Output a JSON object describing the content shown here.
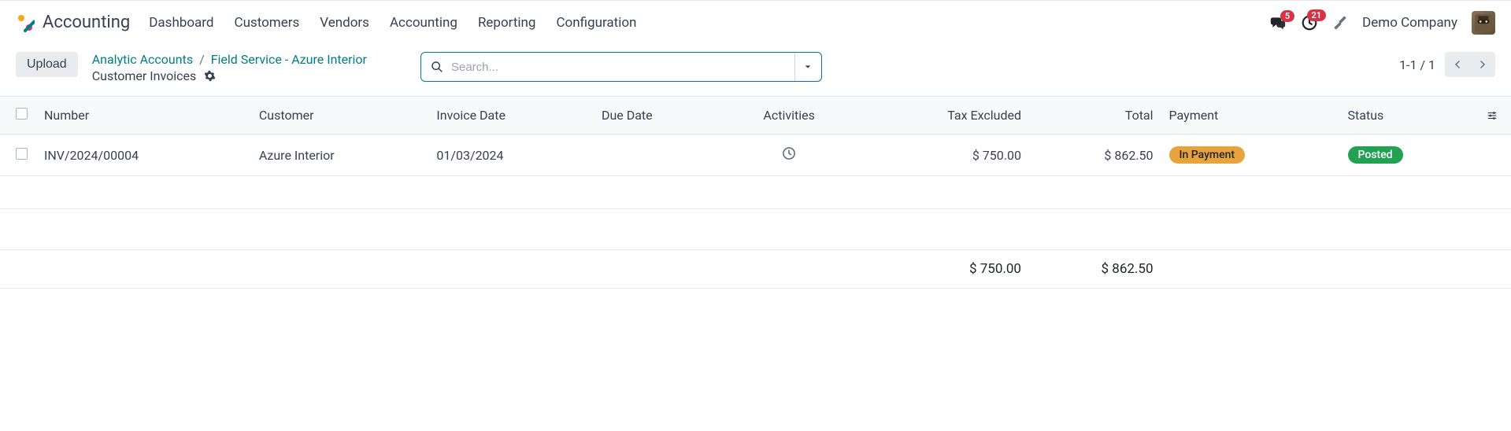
{
  "header": {
    "app_name": "Accounting",
    "nav": [
      "Dashboard",
      "Customers",
      "Vendors",
      "Accounting",
      "Reporting",
      "Configuration"
    ],
    "messages_badge": "5",
    "activities_badge": "21",
    "company": "Demo Company"
  },
  "controls": {
    "upload_label": "Upload",
    "breadcrumb": {
      "l1": "Analytic Accounts",
      "sep": "/",
      "l2": "Field Service - Azure Interior"
    },
    "subtitle": "Customer Invoices",
    "search_placeholder": "Search...",
    "pager": "1-1 / 1"
  },
  "table": {
    "headers": {
      "number": "Number",
      "customer": "Customer",
      "invoice_date": "Invoice Date",
      "due_date": "Due Date",
      "activities": "Activities",
      "tax_excluded": "Tax Excluded",
      "total": "Total",
      "payment": "Payment",
      "status": "Status"
    },
    "rows": [
      {
        "number": "INV/2024/00004",
        "customer": "Azure Interior",
        "invoice_date": "01/03/2024",
        "due_date": "",
        "tax_excluded": "$ 750.00",
        "total": "$ 862.50",
        "payment": "In Payment",
        "status": "Posted"
      }
    ],
    "totals": {
      "tax_excluded": "$ 750.00",
      "total": "$ 862.50"
    }
  }
}
